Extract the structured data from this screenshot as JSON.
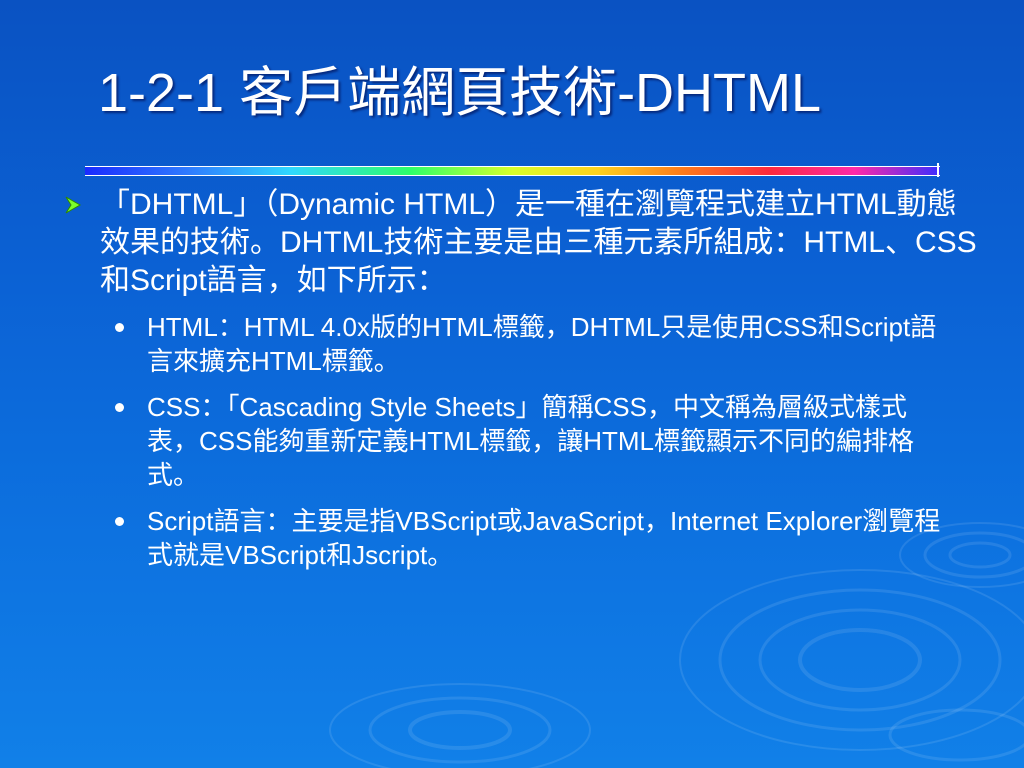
{
  "slide": {
    "title": "1-2-1 客戶端網頁技術-DHTML",
    "main_point": "「DHTML」（Dynamic HTML）是一種在瀏覽程式建立HTML動態效果的技術。DHTML技術主要是由三種元素所組成：HTML、CSS和Script語言，如下所示：",
    "sub_points": [
      "HTML：HTML 4.0x版的HTML標籤，DHTML只是使用CSS和Script語言來擴充HTML標籤。",
      "CSS：「Cascading Style Sheets」簡稱CSS，中文稱為層級式樣式表，CSS能夠重新定義HTML標籤，讓HTML標籤顯示不同的編排格式。",
      "Script語言：主要是指VBScript或JavaScript，Internet Explorer瀏覽程式就是VBScript和Jscript。"
    ]
  },
  "icons": {
    "main_bullet": "arrow-bullet-icon",
    "sub_bullet": "dot-bullet-icon"
  },
  "colors": {
    "background_top": "#0a52c2",
    "background_bottom": "#1180e8",
    "text": "#ffffff",
    "arrow_bullet": "#7cff2a"
  }
}
